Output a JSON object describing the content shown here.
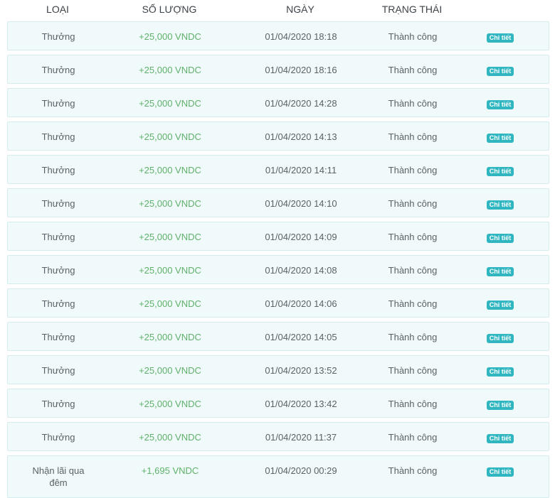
{
  "table": {
    "headers": {
      "type": "LOẠI",
      "amount": "SỐ LƯỢNG",
      "date": "NGÀY",
      "status": "TRẠNG THÁI"
    },
    "rows": [
      {
        "type": "Thưởng",
        "amount": "+25,000 VNDC",
        "date": "01/04/2020 18:18",
        "status": "Thành công",
        "action": "Chi tiết"
      },
      {
        "type": "Thưởng",
        "amount": "+25,000 VNDC",
        "date": "01/04/2020 18:16",
        "status": "Thành công",
        "action": "Chi tiết"
      },
      {
        "type": "Thưởng",
        "amount": "+25,000 VNDC",
        "date": "01/04/2020 14:28",
        "status": "Thành công",
        "action": "Chi tiết"
      },
      {
        "type": "Thưởng",
        "amount": "+25,000 VNDC",
        "date": "01/04/2020 14:13",
        "status": "Thành công",
        "action": "Chi tiết"
      },
      {
        "type": "Thưởng",
        "amount": "+25,000 VNDC",
        "date": "01/04/2020 14:11",
        "status": "Thành công",
        "action": "Chi tiết"
      },
      {
        "type": "Thưởng",
        "amount": "+25,000 VNDC",
        "date": "01/04/2020 14:10",
        "status": "Thành công",
        "action": "Chi tiết"
      },
      {
        "type": "Thưởng",
        "amount": "+25,000 VNDC",
        "date": "01/04/2020 14:09",
        "status": "Thành công",
        "action": "Chi tiết"
      },
      {
        "type": "Thưởng",
        "amount": "+25,000 VNDC",
        "date": "01/04/2020 14:08",
        "status": "Thành công",
        "action": "Chi tiết"
      },
      {
        "type": "Thưởng",
        "amount": "+25,000 VNDC",
        "date": "01/04/2020 14:06",
        "status": "Thành công",
        "action": "Chi tiết"
      },
      {
        "type": "Thưởng",
        "amount": "+25,000 VNDC",
        "date": "01/04/2020 14:05",
        "status": "Thành công",
        "action": "Chi tiết"
      },
      {
        "type": "Thưởng",
        "amount": "+25,000 VNDC",
        "date": "01/04/2020 13:52",
        "status": "Thành công",
        "action": "Chi tiết"
      },
      {
        "type": "Thưởng",
        "amount": "+25,000 VNDC",
        "date": "01/04/2020 13:42",
        "status": "Thành công",
        "action": "Chi tiết"
      },
      {
        "type": "Thưởng",
        "amount": "+25,000 VNDC",
        "date": "01/04/2020 11:37",
        "status": "Thành công",
        "action": "Chi tiết"
      },
      {
        "type": "Nhận lãi qua đêm",
        "amount": "+1,695 VNDC",
        "date": "01/04/2020 00:29",
        "status": "Thành công",
        "action": "Chi tiết"
      }
    ]
  },
  "colors": {
    "row_background": "#f0fafa",
    "row_border": "#d4ecee",
    "amount_positive": "#5fb06a",
    "badge_background": "#2fb6c1"
  }
}
